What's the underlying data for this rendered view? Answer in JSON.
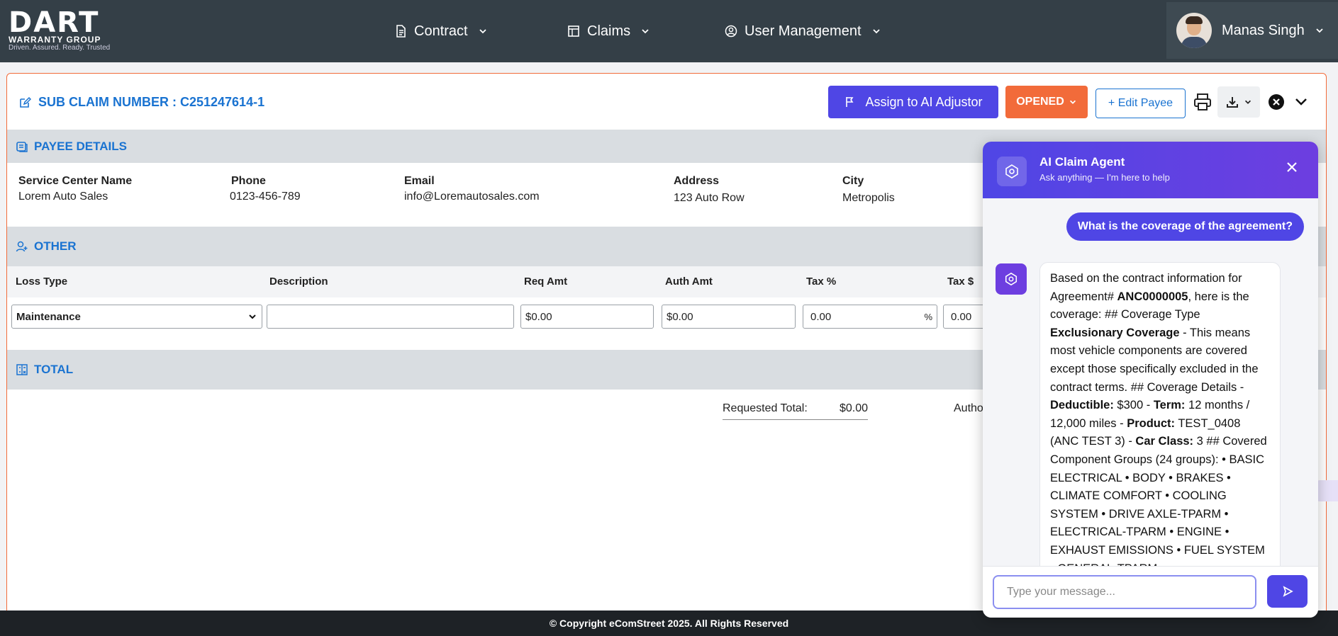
{
  "nav": {
    "logo_main": "DART",
    "logo_sub": "WARRANTY GROUP",
    "logo_tag": "Driven. Assured. Ready. Trusted",
    "items": [
      {
        "label": "Contract"
      },
      {
        "label": "Claims"
      },
      {
        "label": "User Management"
      }
    ],
    "user_name": "Manas Singh"
  },
  "claim": {
    "title": "SUB CLAIM NUMBER : C251247614-1",
    "assign_label": "Assign to AI Adjustor",
    "status_label": "OPENED",
    "edit_payee_label": "+ Edit Payee"
  },
  "payee": {
    "section_label": "PAYEE DETAILS",
    "fields": [
      {
        "label": "Service Center Name",
        "value": "Lorem Auto Sales"
      },
      {
        "label": "Phone",
        "value": "0123-456-789"
      },
      {
        "label": "Email",
        "value": "info@Loremautosales.com"
      },
      {
        "label": "Address",
        "value": "123 Auto Row"
      },
      {
        "label": "City",
        "value": "Metropolis"
      }
    ]
  },
  "other": {
    "section_label": "OTHER",
    "columns": [
      "Loss Type",
      "Description",
      "Req Amt",
      "Auth Amt",
      "Tax %",
      "Tax $"
    ],
    "row": {
      "loss_type": "Maintenance",
      "description": "",
      "req_currency": "$",
      "req_amt": "0.00",
      "auth_currency": "$",
      "auth_amt": "0.00",
      "tax_pct": "0.00",
      "tax_pct_unit": "%",
      "tax_amt": "0.00"
    }
  },
  "total": {
    "section_label": "TOTAL",
    "requested_label": "Requested Total:",
    "requested_value": "$0.00",
    "authorized_label": "Autho"
  },
  "footer": {
    "text": "© Copyright eComStreet 2025. All Rights Reserved"
  },
  "ai": {
    "title": "AI Claim Agent",
    "subtitle": "Ask anything — I'm here to help",
    "user_message": "What is the coverage of the agreement?",
    "bot_message": {
      "t1": "Based on the contract information for Agreement# ",
      "agreement": "ANC0000005",
      "t2": ", here is the coverage: ## Coverage Type ",
      "coverage_type": "Exclusionary Coverage",
      "t3": " - This means most vehicle components are covered except those specifically excluded in the contract terms. ## Coverage Details - ",
      "deductible_label": "Deductible:",
      "deductible_value": " $300 - ",
      "term_label": "Term:",
      "term_value": " 12 months / 12,000 miles - ",
      "product_label": "Product:",
      "product_value": " TEST_0408 (ANC TEST 3) - ",
      "car_class_label": "Car Class:",
      "car_class_value": " 3 ## Covered Component Groups (24 groups): • BASIC ELECTRICAL • BODY • BRAKES • CLIMATE COMFORT • COOLING SYSTEM • DRIVE AXLE-TPARM • ELECTRICAL-TPARM • ENGINE • EXHAUST EMISSIONS • FUEL SYSTEM • GENERAL-TPARM"
    },
    "input_placeholder": "Type your message..."
  }
}
